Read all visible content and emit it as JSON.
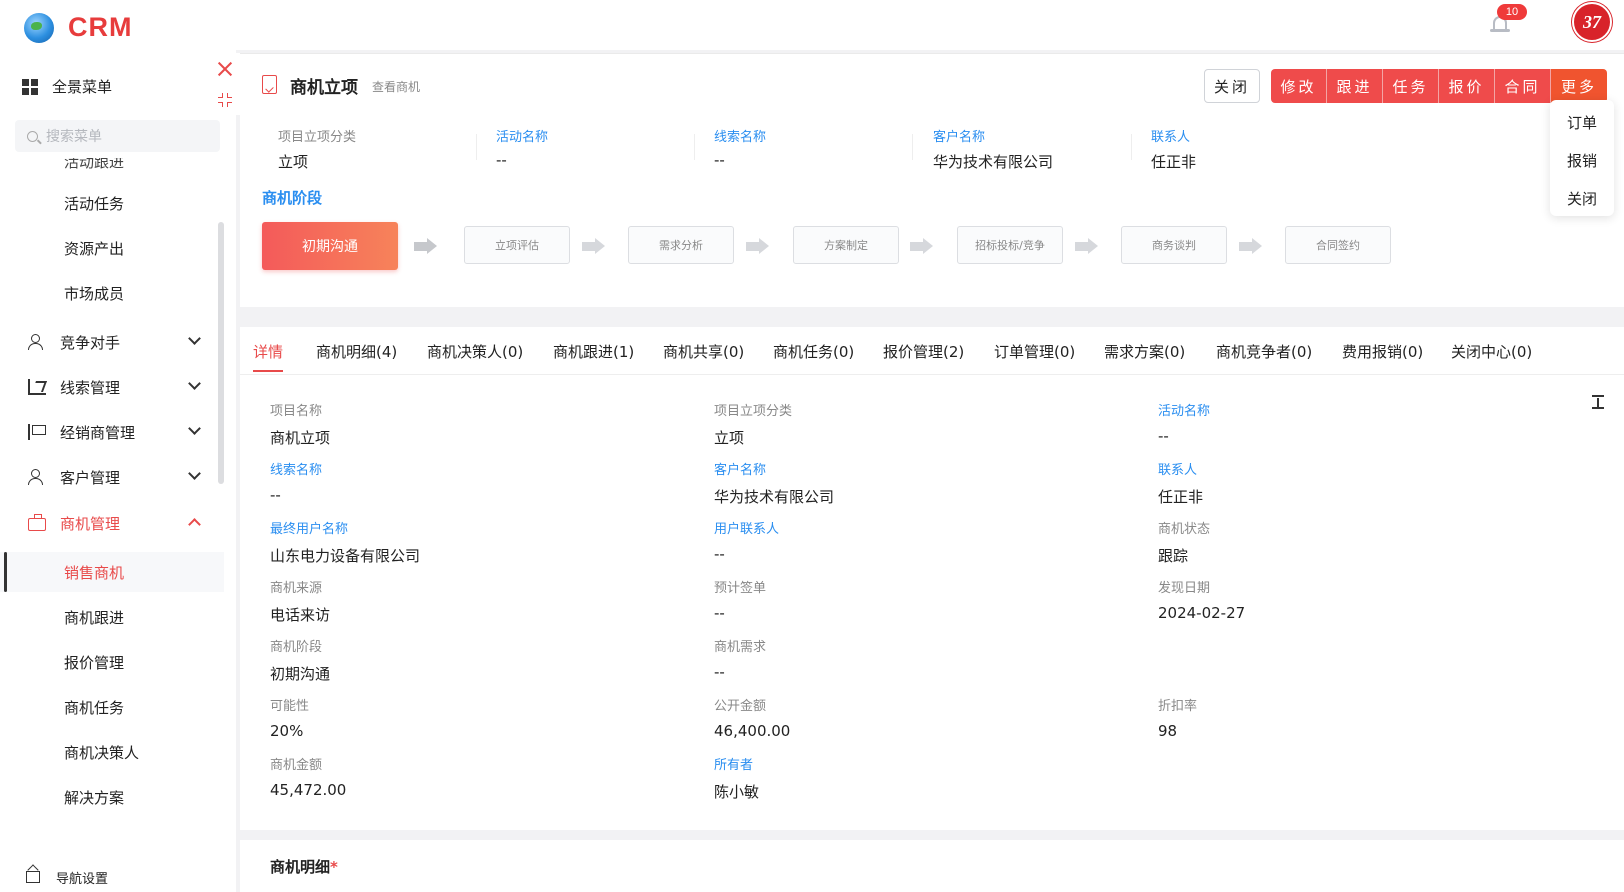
{
  "app": {
    "logo_text": "CRM",
    "notification_count": "10",
    "user_logo_text": "37"
  },
  "sidebar": {
    "full_menu": "全景菜单",
    "search_placeholder": "搜索菜单",
    "partial_item": "活动跟进",
    "sub_items_top": [
      "活动任务",
      "资源产出",
      "市场成员"
    ],
    "groups": [
      "竞争对手",
      "线索管理",
      "经销商管理",
      "客户管理",
      "商机管理"
    ],
    "sub_items": [
      "销售商机",
      "商机跟进",
      "报价管理",
      "商机任务",
      "商机决策人",
      "解决方案"
    ],
    "bottom_label": "导航设置"
  },
  "header": {
    "title": "商机立项",
    "subtitle": "查看商机",
    "close_label": "关闭",
    "actions": [
      "修改",
      "跟进",
      "任务",
      "报价",
      "合同",
      "更多"
    ],
    "more_menu": [
      "订单",
      "报销",
      "关闭"
    ]
  },
  "summary": [
    {
      "label": "项目立项分类",
      "value": "立项"
    },
    {
      "label": "活动名称",
      "value": "--"
    },
    {
      "label": "线索名称",
      "value": "--"
    },
    {
      "label": "客户名称",
      "value": "华为技术有限公司"
    },
    {
      "label": "联系人",
      "value": "任正非"
    }
  ],
  "stages": {
    "title": "商机阶段",
    "items": [
      "初期沟通",
      "立项评估",
      "需求分析",
      "方案制定",
      "招标投标/竞争",
      "商务谈判",
      "合同签约"
    ]
  },
  "tabs": [
    "详情",
    "商机明细(4)",
    "商机决策人(0)",
    "商机跟进(1)",
    "商机共享(0)",
    "商机任务(0)",
    "报价管理(2)",
    "订单管理(0)",
    "需求方案(0)",
    "商机竞争者(0)",
    "费用报销(0)",
    "关闭中心(0)"
  ],
  "details": [
    {
      "label": "项目名称",
      "value": "商机立项"
    },
    {
      "label": "项目立项分类",
      "value": "立项"
    },
    {
      "label": "活动名称",
      "value": "--"
    },
    {
      "label": "线索名称",
      "value": "--"
    },
    {
      "label": "客户名称",
      "value": "华为技术有限公司"
    },
    {
      "label": "联系人",
      "value": "任正非"
    },
    {
      "label": "最终用户名称",
      "value": "山东电力设备有限公司"
    },
    {
      "label": "用户联系人",
      "value": "--"
    },
    {
      "label": "商机状态",
      "value": "跟踪"
    },
    {
      "label": "商机来源",
      "value": "电话来访"
    },
    {
      "label": "预计签单",
      "value": "--"
    },
    {
      "label": "发现日期",
      "value": "2024-02-27"
    },
    {
      "label": "商机阶段",
      "value": "初期沟通"
    },
    {
      "label": "商机需求",
      "value": "--"
    },
    {
      "label": "可能性",
      "value": "20%"
    },
    {
      "label": "公开金额",
      "value": "46,400.00"
    },
    {
      "label": "折扣率",
      "value": "98"
    },
    {
      "label": "商机金额",
      "value": "45,472.00"
    },
    {
      "label": "所有者",
      "value": "陈小敏"
    }
  ],
  "section": {
    "title": "商机明细",
    "required_mark": "*"
  },
  "colors": {
    "accent": "#e84a4a",
    "link": "#2a8ef0",
    "more_button": "#f0542f"
  }
}
